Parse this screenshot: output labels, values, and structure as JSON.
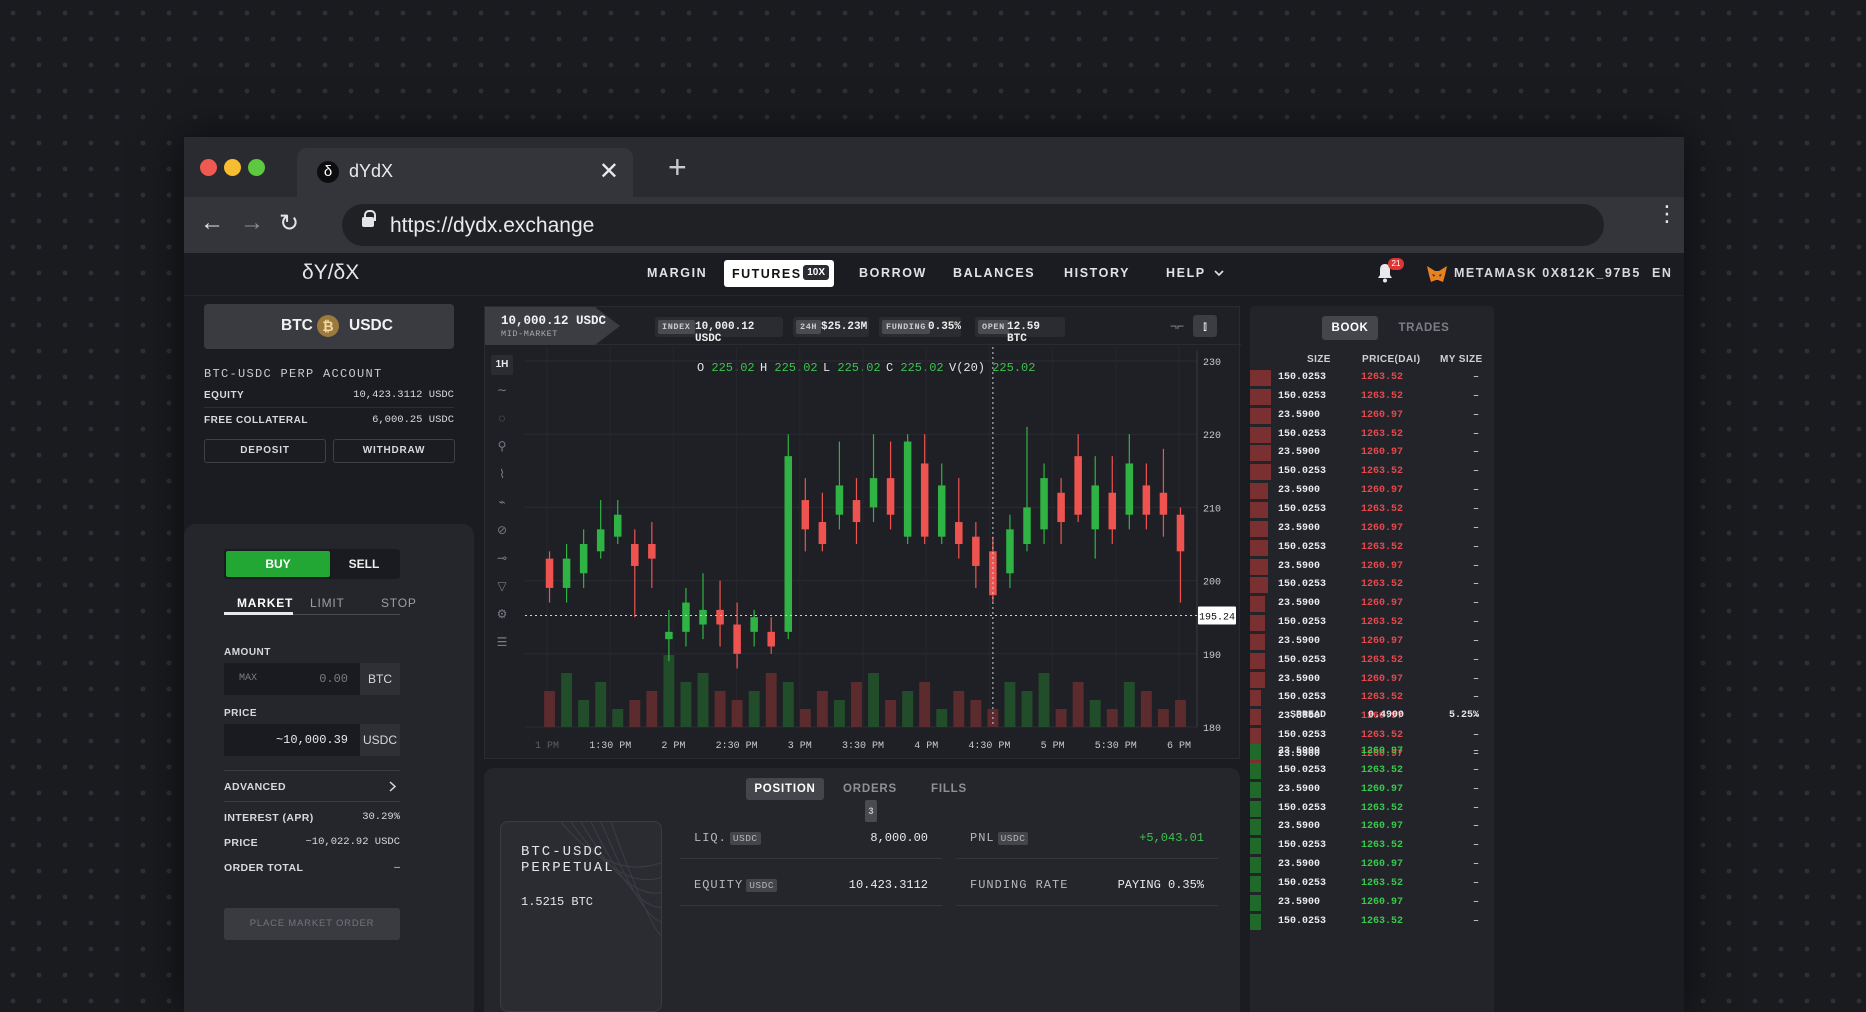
{
  "browser": {
    "tab_title": "dYdX",
    "tab_icon_glyph": "δ",
    "close_glyph": "✕",
    "new_tab_glyph": "+",
    "url": "https://dydx.exchange",
    "back_glyph": "←",
    "forward_glyph": "→",
    "reload_glyph": "↻",
    "menu_glyph": "⋮"
  },
  "app": {
    "logo": "δY/δX",
    "nav": {
      "margin": "MARGIN",
      "futures": "FUTURES",
      "futures_badge": "10X",
      "borrow": "BORROW",
      "balances": "BALANCES",
      "history": "HISTORY",
      "help": "HELP"
    },
    "notifications_count": "21",
    "account": "METAMASK 0X812K_97B5",
    "language": "EN"
  },
  "left": {
    "pair_base": "BTC",
    "pair_quote": "USDC",
    "coin_glyph": "₿",
    "account_title": "BTC-USDC PERP ACCOUNT",
    "equity_label": "EQUITY",
    "equity_value": "10,423.3112 USDC",
    "collateral_label": "FREE COLLATERAL",
    "collateral_value": "6,000.25 USDC",
    "deposit": "DEPOSIT",
    "withdraw": "WITHDRAW",
    "buy": "BUY",
    "sell": "SELL",
    "order_types": [
      "MARKET",
      "LIMIT",
      "STOP"
    ],
    "amount_label": "AMOUNT",
    "amount_max": "MAX",
    "amount_value": "0.00",
    "amount_unit": "BTC",
    "price_label": "PRICE",
    "price_value": "~10,000.39",
    "price_unit": "USDC",
    "advanced": "ADVANCED",
    "interest_label": "INTEREST (APR)",
    "interest_value": "30.29%",
    "price2_label": "PRICE",
    "price2_value": "~10,022.92 USDC",
    "order_total_label": "ORDER TOTAL",
    "order_total_value": "–",
    "place_order": "PLACE MARKET ORDER"
  },
  "chart_header": {
    "mid_value": "10,000.12 USDC",
    "mid_label": "MID-MARKET",
    "index_label": "INDEX",
    "index_value": "10,000.12 USDC",
    "vol_label": "24H",
    "vol_value": "$25.23M",
    "funding_label": "FUNDING",
    "funding_value": "0.35%",
    "open_label": "OPEN",
    "open_value": "12.59 BTC"
  },
  "chart_data": {
    "type": "candlestick",
    "interval": "1H",
    "ohlc_readout": {
      "O": "225.02",
      "H": "225.02",
      "L": "225.02",
      "C": "225.02",
      "V(20)": "225.02"
    },
    "ylim": [
      180,
      230
    ],
    "yticks": [
      180,
      190,
      200,
      210,
      220,
      230
    ],
    "x_ticks": [
      "1 PM",
      "1:30 PM",
      "2 PM",
      "2:30 PM",
      "3 PM",
      "3:30 PM",
      "4 PM",
      "4:30 PM",
      "5 PM",
      "5:30 PM",
      "6 PM"
    ],
    "crosshair_price": "195.24",
    "up_color": "#2fb344",
    "down_color": "#ef5350",
    "candles": [
      {
        "o": 203,
        "h": 204,
        "l": 197,
        "c": 199
      },
      {
        "o": 199,
        "h": 205,
        "l": 197,
        "c": 203
      },
      {
        "o": 201,
        "h": 207,
        "l": 199,
        "c": 205
      },
      {
        "o": 204,
        "h": 211,
        "l": 203,
        "c": 207
      },
      {
        "o": 206,
        "h": 211,
        "l": 205,
        "c": 209
      },
      {
        "o": 205,
        "h": 207,
        "l": 195,
        "c": 202
      },
      {
        "o": 205,
        "h": 208,
        "l": 199,
        "c": 203
      },
      {
        "o": 192,
        "h": 196,
        "l": 189,
        "c": 193
      },
      {
        "o": 193,
        "h": 199,
        "l": 191,
        "c": 197
      },
      {
        "o": 194,
        "h": 201,
        "l": 192,
        "c": 196
      },
      {
        "o": 196,
        "h": 200,
        "l": 191,
        "c": 194
      },
      {
        "o": 194,
        "h": 197,
        "l": 188,
        "c": 190
      },
      {
        "o": 193,
        "h": 196,
        "l": 191,
        "c": 195
      },
      {
        "o": 193,
        "h": 195,
        "l": 190,
        "c": 191
      },
      {
        "o": 193,
        "h": 220,
        "l": 192,
        "c": 217
      },
      {
        "o": 211,
        "h": 214,
        "l": 204,
        "c": 207
      },
      {
        "o": 208,
        "h": 212,
        "l": 204,
        "c": 205
      },
      {
        "o": 209,
        "h": 219,
        "l": 207,
        "c": 213
      },
      {
        "o": 211,
        "h": 214,
        "l": 205,
        "c": 208
      },
      {
        "o": 210,
        "h": 220,
        "l": 208,
        "c": 214
      },
      {
        "o": 214,
        "h": 219,
        "l": 207,
        "c": 209
      },
      {
        "o": 206,
        "h": 220,
        "l": 205,
        "c": 219
      },
      {
        "o": 216,
        "h": 220,
        "l": 205,
        "c": 206
      },
      {
        "o": 206,
        "h": 216,
        "l": 205,
        "c": 213
      },
      {
        "o": 208,
        "h": 214,
        "l": 203,
        "c": 205
      },
      {
        "o": 206,
        "h": 208,
        "l": 199,
        "c": 202
      },
      {
        "o": 204,
        "h": 206,
        "l": 197,
        "c": 198
      },
      {
        "o": 201,
        "h": 209,
        "l": 199,
        "c": 207
      },
      {
        "o": 205,
        "h": 221,
        "l": 204,
        "c": 210
      },
      {
        "o": 207,
        "h": 216,
        "l": 205,
        "c": 214
      },
      {
        "o": 212,
        "h": 214,
        "l": 205,
        "c": 208
      },
      {
        "o": 217,
        "h": 220,
        "l": 208,
        "c": 209
      },
      {
        "o": 207,
        "h": 217,
        "l": 203,
        "c": 213
      },
      {
        "o": 212,
        "h": 217,
        "l": 205,
        "c": 207
      },
      {
        "o": 209,
        "h": 220,
        "l": 207,
        "c": 216
      },
      {
        "o": 213,
        "h": 216,
        "l": 207,
        "c": 209
      },
      {
        "o": 212,
        "h": 218,
        "l": 206,
        "c": 209
      },
      {
        "o": 209,
        "h": 210,
        "l": 197,
        "c": 204
      }
    ],
    "volume": [
      4,
      6,
      3,
      5,
      2,
      3,
      4,
      8,
      5,
      6,
      4,
      3,
      4,
      6,
      5,
      2,
      4,
      3,
      5,
      6,
      3,
      4,
      5,
      2,
      4,
      3,
      2,
      5,
      4,
      6,
      2,
      5,
      3,
      2,
      5,
      4,
      2,
      3
    ]
  },
  "bottom": {
    "tabs": {
      "position": "POSITION",
      "orders": "ORDERS",
      "orders_count": "3",
      "fills": "FILLS"
    },
    "card_title_1": "BTC-USDC",
    "card_title_2": "PERPETUAL",
    "card_amount": "1.5215 BTC",
    "liq_label": "LIQ.",
    "liq_tag": "USDC",
    "liq_value": "8,000.00",
    "pnl_label": "PNL",
    "pnl_tag": "USDC",
    "pnl_value": "+5,043.01",
    "equity_label": "EQUITY",
    "equity_tag": "USDC",
    "equity_value": "10.423.3112",
    "funding_label": "FUNDING RATE",
    "funding_value": "PAYING 0.35%"
  },
  "book": {
    "tab_book": "BOOK",
    "tab_trades": "TRADES",
    "col_size": "SIZE",
    "col_price": "PRICE(DAI)",
    "col_my": "MY SIZE",
    "asks": [
      {
        "size": "150.0253",
        "price": "1263.52",
        "my": "–",
        "depth": 0.95
      },
      {
        "size": "150.0253",
        "price": "1263.52",
        "my": "–",
        "depth": 0.95
      },
      {
        "size": "23.5900",
        "price": "1260.97",
        "my": "–",
        "depth": 0.95
      },
      {
        "size": "150.0253",
        "price": "1263.52",
        "my": "–",
        "depth": 0.95
      },
      {
        "size": "23.5900",
        "price": "1260.97",
        "my": "–",
        "depth": 0.95
      },
      {
        "size": "150.0253",
        "price": "1263.52",
        "my": "–",
        "depth": 0.95
      },
      {
        "size": "23.5900",
        "price": "1260.97",
        "my": "–",
        "depth": 0.8
      },
      {
        "size": "150.0253",
        "price": "1263.52",
        "my": "–",
        "depth": 0.8
      },
      {
        "size": "23.5900",
        "price": "1260.97",
        "my": "–",
        "depth": 0.8
      },
      {
        "size": "150.0253",
        "price": "1263.52",
        "my": "–",
        "depth": 0.8
      },
      {
        "size": "23.5900",
        "price": "1260.97",
        "my": "–",
        "depth": 0.8
      },
      {
        "size": "150.0253",
        "price": "1263.52",
        "my": "–",
        "depth": 0.8
      },
      {
        "size": "23.5900",
        "price": "1260.97",
        "my": "–",
        "depth": 0.7
      },
      {
        "size": "150.0253",
        "price": "1263.52",
        "my": "–",
        "depth": 0.7
      },
      {
        "size": "23.5900",
        "price": "1260.97",
        "my": "–",
        "depth": 0.7
      },
      {
        "size": "150.0253",
        "price": "1263.52",
        "my": "–",
        "depth": 0.7
      },
      {
        "size": "23.5900",
        "price": "1260.97",
        "my": "–",
        "depth": 0.7
      },
      {
        "size": "150.0253",
        "price": "1263.52",
        "my": "–",
        "depth": 0.5
      },
      {
        "size": "23.5900",
        "price": "1260.97",
        "my": "–",
        "depth": 0.5
      },
      {
        "size": "150.0253",
        "price": "1263.52",
        "my": "–",
        "depth": 0.5
      },
      {
        "size": "23.5900",
        "price": "1260.97",
        "my": "–",
        "depth": 0.5
      }
    ],
    "spread_label": "SPREAD",
    "spread_value": "0.4900",
    "spread_pct": "5.25%",
    "bids": [
      {
        "size": "23.5900",
        "price": "1260.97",
        "my": "–",
        "depth": 0.5
      },
      {
        "size": "150.0253",
        "price": "1263.52",
        "my": "–",
        "depth": 0.5
      },
      {
        "size": "23.5900",
        "price": "1260.97",
        "my": "–",
        "depth": 0.5
      },
      {
        "size": "150.0253",
        "price": "1263.52",
        "my": "–",
        "depth": 0.5
      },
      {
        "size": "23.5900",
        "price": "1260.97",
        "my": "–",
        "depth": 0.5
      },
      {
        "size": "150.0253",
        "price": "1263.52",
        "my": "–",
        "depth": 0.5
      },
      {
        "size": "23.5900",
        "price": "1260.97",
        "my": "–",
        "depth": 0.5
      },
      {
        "size": "150.0253",
        "price": "1263.52",
        "my": "–",
        "depth": 0.5
      },
      {
        "size": "23.5900",
        "price": "1260.97",
        "my": "–",
        "depth": 0.5
      },
      {
        "size": "150.0253",
        "price": "1263.52",
        "my": "–",
        "depth": 0.5
      }
    ],
    "ask_color": "#e5484d",
    "bid_color": "#37c94c"
  }
}
